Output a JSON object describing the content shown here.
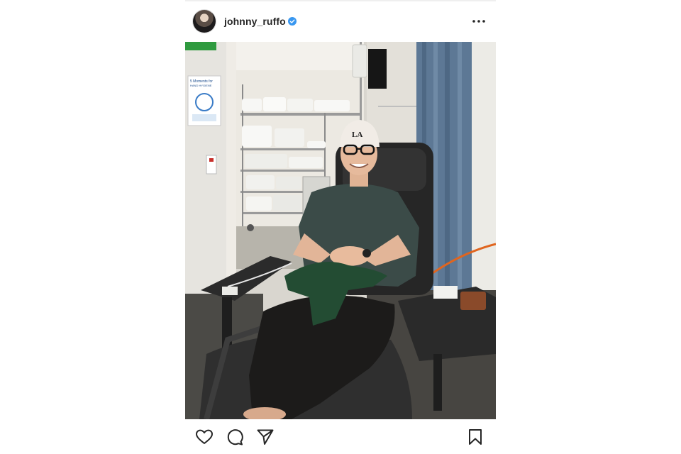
{
  "post": {
    "username": "johnny_ruffo",
    "verified": true,
    "icons": {
      "avatar": "profile-avatar",
      "verified": "verified-badge-icon",
      "more": "more-options-icon",
      "like": "heart-icon",
      "comment": "comment-bubble-icon",
      "share": "paper-plane-icon",
      "save": "bookmark-icon"
    },
    "image": {
      "poster_title": "5 Moments for",
      "poster_subtitle": "HAND HYGIENE",
      "cap_text": "LA"
    },
    "colors": {
      "verified_blue": "#3897f0",
      "text": "#262626"
    }
  }
}
